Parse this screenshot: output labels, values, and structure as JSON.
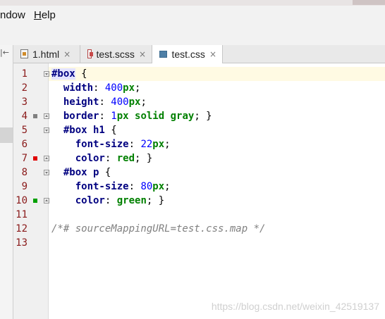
{
  "menubar": {
    "items": [
      {
        "label": "ndow",
        "underline": ""
      },
      {
        "label": "Help",
        "underline": "H"
      }
    ]
  },
  "tabs": [
    {
      "label": "1.html",
      "type": "html",
      "active": false
    },
    {
      "label": "test.scss",
      "type": "scss",
      "active": false
    },
    {
      "label": "test.css",
      "type": "css",
      "active": true
    }
  ],
  "tab_close_glyph": "×",
  "side_collapse_glyph": "|←",
  "editor": {
    "lines": [
      {
        "no": "1",
        "indent": "",
        "tokens": [
          {
            "t": "#box",
            "c": "sel-tok hl-bg"
          },
          {
            "t": " {",
            "c": "punc"
          }
        ],
        "marker": "",
        "fold": "open"
      },
      {
        "no": "2",
        "indent": "  ",
        "tokens": [
          {
            "t": "width",
            "c": "prop"
          },
          {
            "t": ": ",
            "c": "punc"
          },
          {
            "t": "400",
            "c": "num"
          },
          {
            "t": "px",
            "c": "unit"
          },
          {
            "t": ";",
            "c": "punc"
          }
        ],
        "marker": "",
        "fold": ""
      },
      {
        "no": "3",
        "indent": "  ",
        "tokens": [
          {
            "t": "height",
            "c": "prop"
          },
          {
            "t": ": ",
            "c": "punc"
          },
          {
            "t": "400",
            "c": "num"
          },
          {
            "t": "px",
            "c": "unit"
          },
          {
            "t": ";",
            "c": "punc"
          }
        ],
        "marker": "",
        "fold": ""
      },
      {
        "no": "4",
        "indent": "  ",
        "tokens": [
          {
            "t": "border",
            "c": "prop"
          },
          {
            "t": ": ",
            "c": "punc"
          },
          {
            "t": "1",
            "c": "num"
          },
          {
            "t": "px solid gray",
            "c": "val"
          },
          {
            "t": "; }",
            "c": "punc"
          }
        ],
        "marker": "gray",
        "fold": "end"
      },
      {
        "no": "5",
        "indent": "  ",
        "tokens": [
          {
            "t": "#box h1",
            "c": "sel-tok"
          },
          {
            "t": " {",
            "c": "punc"
          }
        ],
        "marker": "",
        "fold": "open"
      },
      {
        "no": "6",
        "indent": "    ",
        "tokens": [
          {
            "t": "font-size",
            "c": "prop"
          },
          {
            "t": ": ",
            "c": "punc"
          },
          {
            "t": "22",
            "c": "num"
          },
          {
            "t": "px",
            "c": "unit"
          },
          {
            "t": ";",
            "c": "punc"
          }
        ],
        "marker": "",
        "fold": ""
      },
      {
        "no": "7",
        "indent": "    ",
        "tokens": [
          {
            "t": "color",
            "c": "prop"
          },
          {
            "t": ": ",
            "c": "punc"
          },
          {
            "t": "red",
            "c": "val"
          },
          {
            "t": "; }",
            "c": "punc"
          }
        ],
        "marker": "red",
        "fold": "end"
      },
      {
        "no": "8",
        "indent": "  ",
        "tokens": [
          {
            "t": "#box p",
            "c": "sel-tok"
          },
          {
            "t": " {",
            "c": "punc"
          }
        ],
        "marker": "",
        "fold": "open"
      },
      {
        "no": "9",
        "indent": "    ",
        "tokens": [
          {
            "t": "font-size",
            "c": "prop"
          },
          {
            "t": ": ",
            "c": "punc"
          },
          {
            "t": "80",
            "c": "num"
          },
          {
            "t": "px",
            "c": "unit"
          },
          {
            "t": ";",
            "c": "punc"
          }
        ],
        "marker": "",
        "fold": ""
      },
      {
        "no": "10",
        "indent": "    ",
        "tokens": [
          {
            "t": "color",
            "c": "prop"
          },
          {
            "t": ": ",
            "c": "punc"
          },
          {
            "t": "green",
            "c": "val"
          },
          {
            "t": "; }",
            "c": "punc"
          }
        ],
        "marker": "green",
        "fold": "end"
      },
      {
        "no": "11",
        "indent": "",
        "tokens": [],
        "marker": "",
        "fold": ""
      },
      {
        "no": "12",
        "indent": "",
        "tokens": [
          {
            "t": "/*# sourceMappingURL=test.css.map */",
            "c": "comment"
          }
        ],
        "marker": "",
        "fold": ""
      },
      {
        "no": "13",
        "indent": "",
        "tokens": [],
        "marker": "",
        "fold": ""
      }
    ]
  },
  "marker_colors": {
    "gray": "#808080",
    "red": "#e00000",
    "green": "#00a000"
  },
  "watermark": "https://blog.csdn.net/weixin_42519137"
}
